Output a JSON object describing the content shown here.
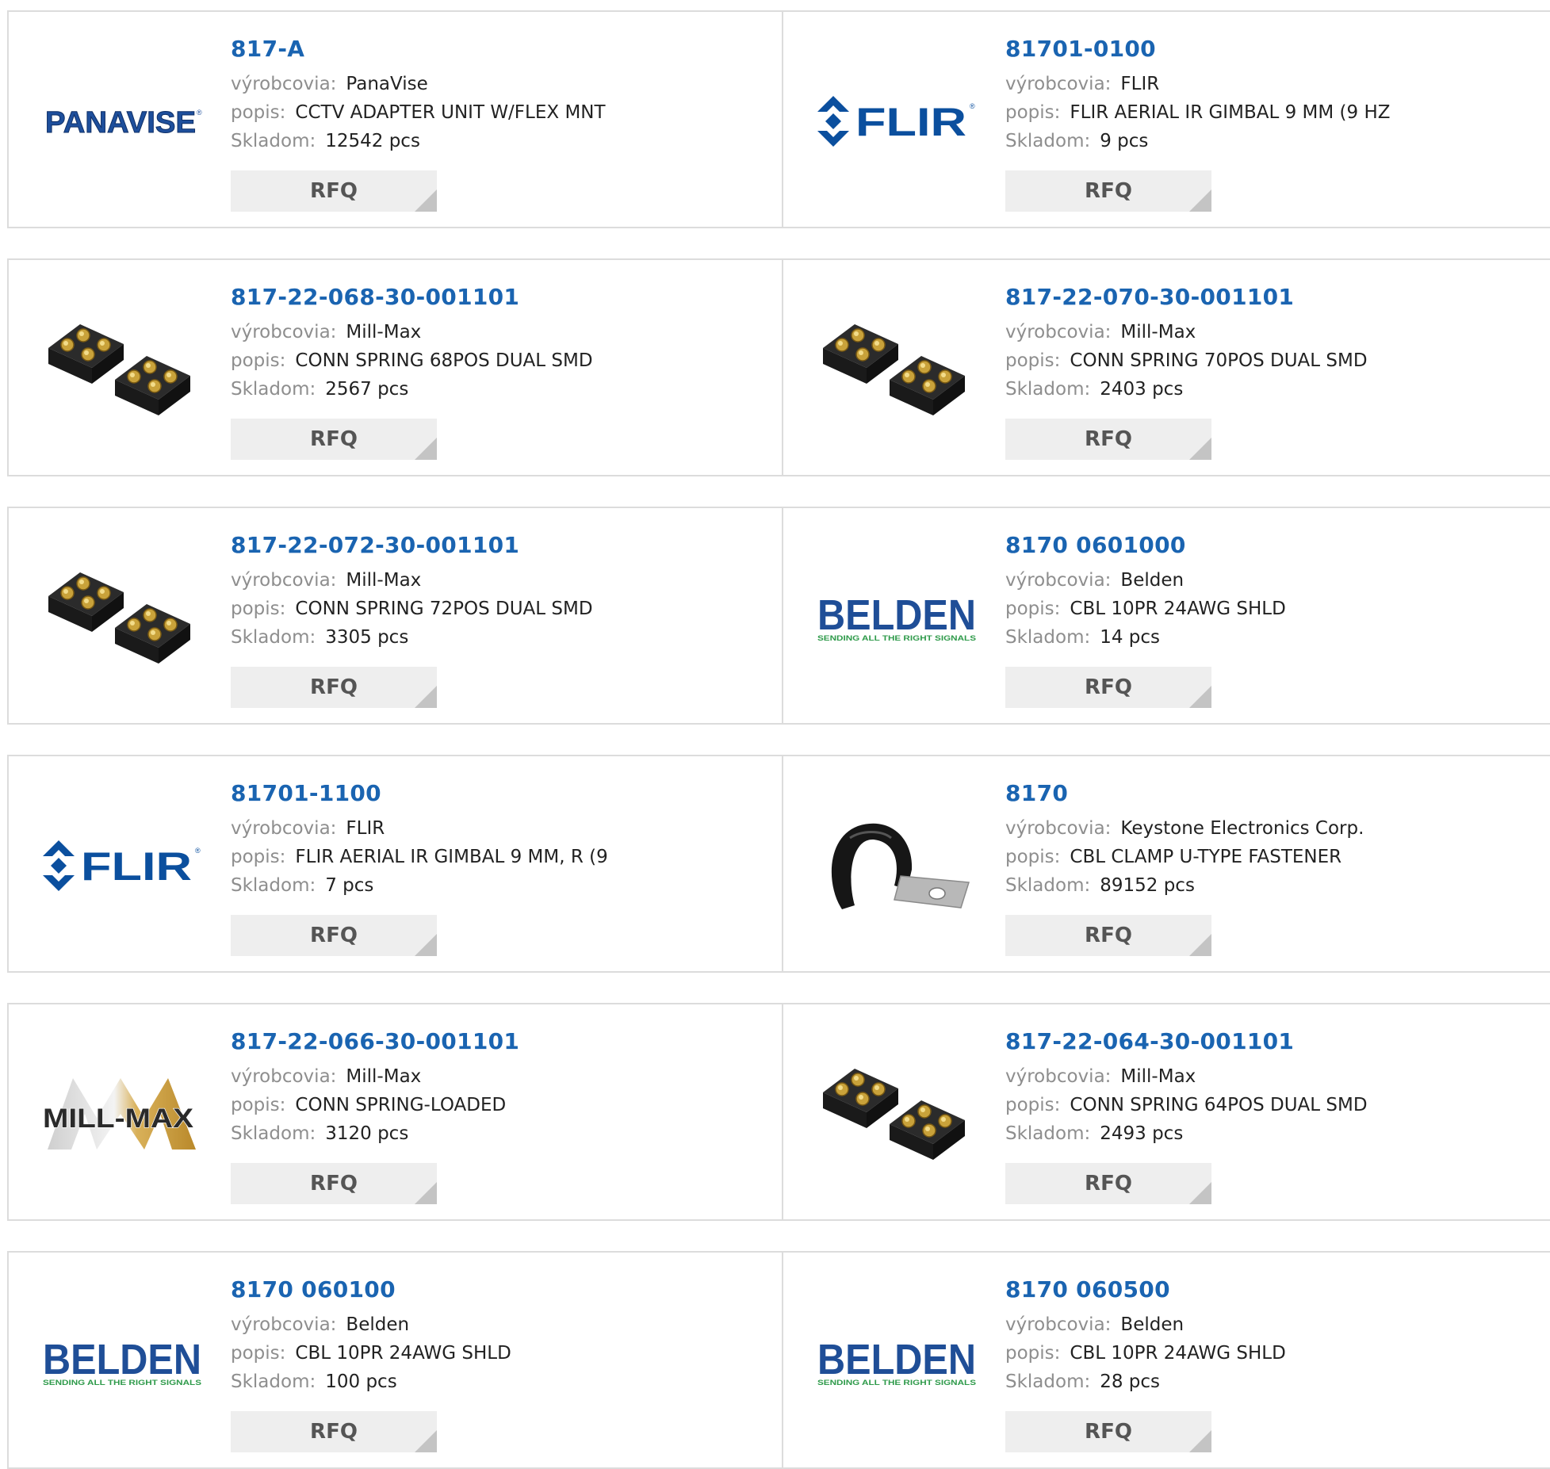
{
  "labels": {
    "manufacturer": "výrobcovia:",
    "description": "popis:",
    "stock": "Skladom:",
    "rfq": "RFQ"
  },
  "colors": {
    "link": "#1a64b1",
    "label": "#8e8e8e",
    "value": "#222222",
    "rfq_bg": "#eeeeee",
    "border": "#dcdcdc"
  },
  "logo_text": {
    "panavise": "PANAVISE",
    "flir": "FLIR",
    "belden": "BELDEN",
    "belden_tagline": "SENDING ALL THE RIGHT SIGNALS",
    "millmax": "MILL-MAX"
  },
  "products": [
    {
      "part": "817-A",
      "manufacturer": "PanaVise",
      "description": "CCTV ADAPTER UNIT W/FLEX MNT",
      "stock": "12542 pcs",
      "logo": "panavise-logo"
    },
    {
      "part": "81701-0100",
      "manufacturer": "FLIR",
      "description": "FLIR AERIAL IR GIMBAL 9 MM (9 HZ",
      "stock": "9 pcs",
      "logo": "flir-logo"
    },
    {
      "part": "817-22-068-30-001101",
      "manufacturer": "Mill-Max",
      "description": "CONN SPRING 68POS DUAL SMD",
      "stock": "2567 pcs",
      "logo": "spring-connector-image"
    },
    {
      "part": "817-22-070-30-001101",
      "manufacturer": "Mill-Max",
      "description": "CONN SPRING 70POS DUAL SMD",
      "stock": "2403 pcs",
      "logo": "spring-connector-image"
    },
    {
      "part": "817-22-072-30-001101",
      "manufacturer": "Mill-Max",
      "description": "CONN SPRING 72POS DUAL SMD",
      "stock": "3305 pcs",
      "logo": "spring-connector-image"
    },
    {
      "part": "8170 0601000",
      "manufacturer": "Belden",
      "description": "CBL 10PR 24AWG SHLD",
      "stock": "14 pcs",
      "logo": "belden-logo"
    },
    {
      "part": "81701-1100",
      "manufacturer": "FLIR",
      "description": "FLIR AERIAL IR GIMBAL 9 MM, R (9",
      "stock": "7 pcs",
      "logo": "flir-logo"
    },
    {
      "part": "8170",
      "manufacturer": "Keystone Electronics Corp.",
      "description": "CBL CLAMP U-TYPE FASTENER",
      "stock": "89152 pcs",
      "logo": "cable-clamp-image"
    },
    {
      "part": "817-22-066-30-001101",
      "manufacturer": "Mill-Max",
      "description": "CONN SPRING-LOADED",
      "stock": "3120 pcs",
      "logo": "millmax-logo"
    },
    {
      "part": "817-22-064-30-001101",
      "manufacturer": "Mill-Max",
      "description": "CONN SPRING 64POS DUAL SMD",
      "stock": "2493 pcs",
      "logo": "spring-connector-image"
    },
    {
      "part": "8170 060100",
      "manufacturer": "Belden",
      "description": "CBL 10PR 24AWG SHLD",
      "stock": "100 pcs",
      "logo": "belden-logo"
    },
    {
      "part": "8170 060500",
      "manufacturer": "Belden",
      "description": "CBL 10PR 24AWG SHLD",
      "stock": "28 pcs",
      "logo": "belden-logo"
    }
  ]
}
